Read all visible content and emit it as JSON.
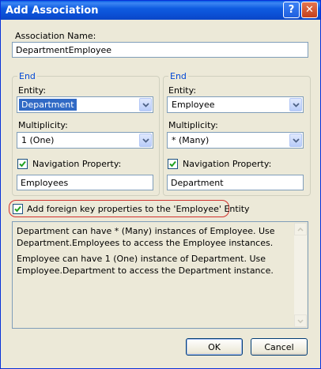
{
  "window": {
    "title": "Add Association",
    "help_glyph": "?",
    "close_glyph": "✕"
  },
  "association_name": {
    "label": "Association Name:",
    "value": "DepartmentEmployee"
  },
  "end1": {
    "group_title": "End",
    "entity_label": "Entity:",
    "entity_value": "Department",
    "multiplicity_label": "Multiplicity:",
    "multiplicity_value": "1 (One)",
    "nav_checked": true,
    "nav_label": "Navigation Property:",
    "nav_value": "Employees"
  },
  "end2": {
    "group_title": "End",
    "entity_label": "Entity:",
    "entity_value": "Employee",
    "multiplicity_label": "Multiplicity:",
    "multiplicity_value": "* (Many)",
    "nav_checked": true,
    "nav_label": "Navigation Property:",
    "nav_value": "Department"
  },
  "foreign_key": {
    "checked": true,
    "label": "Add foreign key properties to the 'Employee' Entity"
  },
  "description": {
    "para1": "Department can have * (Many) instances of Employee. Use Department.Employees to access the Employee instances.",
    "para2": "Employee can have 1 (One) instance of Department. Use Employee.Department to access the Department instance."
  },
  "buttons": {
    "ok": "OK",
    "cancel": "Cancel"
  },
  "colors": {
    "titlebar": "#0a5ee6",
    "group_title": "#0046d5",
    "highlight_border": "#d2322d",
    "selection": "#316ac5"
  },
  "icons": {
    "checkbox_check": "check-icon",
    "dropdown": "chevron-down-icon"
  }
}
